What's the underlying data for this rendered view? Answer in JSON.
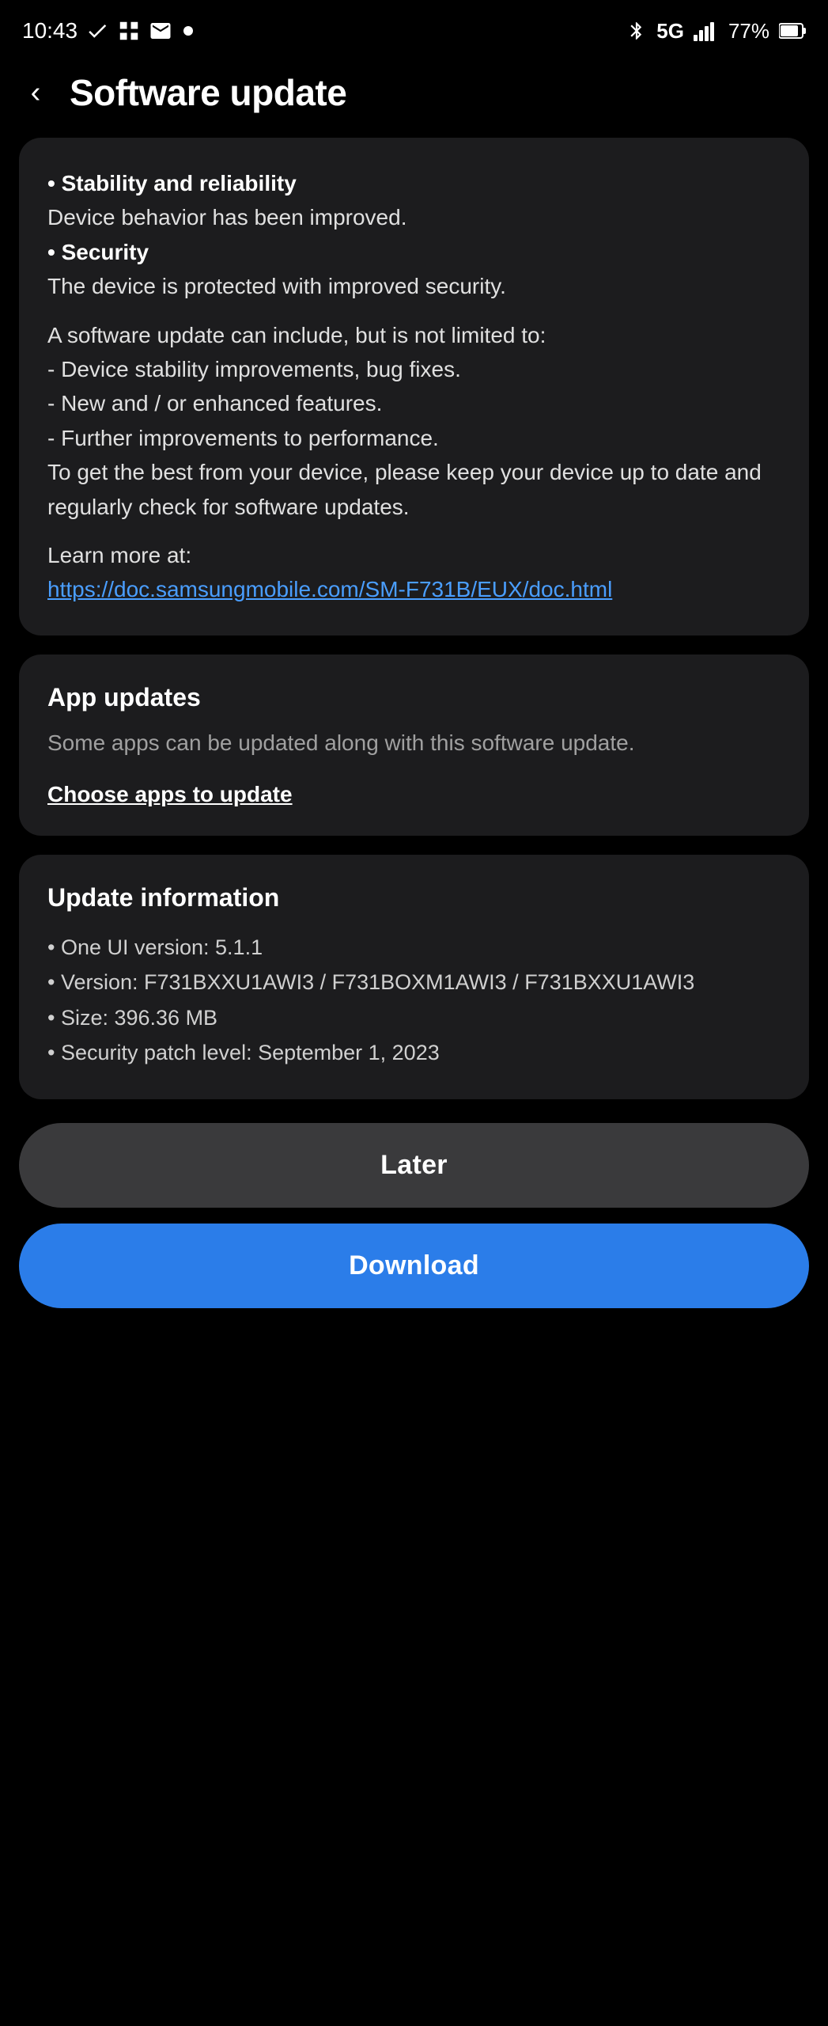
{
  "status_bar": {
    "time": "10:43",
    "battery": "77%",
    "signal": "5G"
  },
  "header": {
    "back_label": "‹",
    "title": "Software update"
  },
  "update_notes": {
    "bullet1_title": "• Stability and reliability",
    "bullet1_desc": "Device behavior has been improved.",
    "bullet2_title": "• Security",
    "bullet2_desc": "The device is protected with improved security.",
    "general_intro": "A software update can include, but is not limited to:",
    "item1": " - Device stability improvements, bug fixes.",
    "item2": " - New and / or enhanced features.",
    "item3": " - Further improvements to performance.",
    "footer_text": "To get the best from your device, please keep your device up to date and regularly check for software updates.",
    "learn_more_label": "Learn more at:",
    "link_text": "https://doc.samsungmobile.com/SM-F731B/EUX/doc.html",
    "link_href": "https://doc.samsungmobile.com/SM-F731B/EUX/doc.html"
  },
  "app_updates": {
    "title": "App updates",
    "description": "Some apps can be updated along with this software update.",
    "choose_label": "Choose apps to update"
  },
  "update_info": {
    "title": "Update information",
    "one_ui": "• One UI version: 5.1.1",
    "version": "• Version: F731BXXU1AWI3 / F731BOXM1AWI3 / F731BXXU1AWI3",
    "size": "• Size: 396.36 MB",
    "security_patch": "• Security patch level: September 1, 2023"
  },
  "buttons": {
    "later_label": "Later",
    "download_label": "Download"
  }
}
